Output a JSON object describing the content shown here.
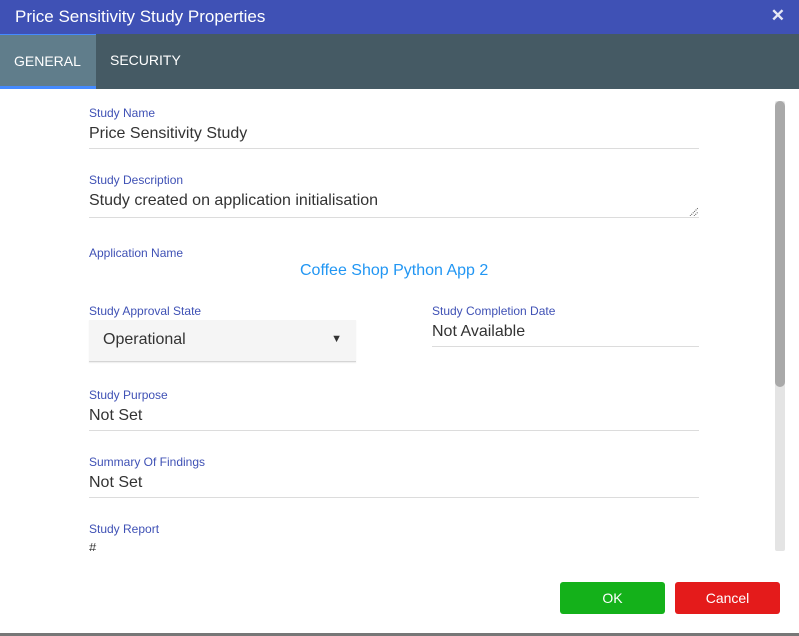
{
  "dialog": {
    "title": "Price Sensitivity Study Properties",
    "close_icon": "close-icon"
  },
  "tabs": [
    {
      "label": "GENERAL",
      "active": true
    },
    {
      "label": "SECURITY",
      "active": false
    }
  ],
  "fields": {
    "study_name": {
      "label": "Study Name",
      "value": "Price Sensitivity Study"
    },
    "study_description": {
      "label": "Study Description",
      "value": "Study created on application initialisation"
    },
    "application_name": {
      "label": "Application Name",
      "value": "Coffee Shop Python App 2"
    },
    "approval_state": {
      "label": "Study Approval State",
      "value": "Operational"
    },
    "completion_date": {
      "label": "Study Completion Date",
      "value": "Not Available"
    },
    "study_purpose": {
      "label": "Study Purpose",
      "value": "Not Set"
    },
    "summary_of_findings": {
      "label": "Summary Of Findings",
      "value": "Not Set"
    },
    "study_report": {
      "label": "Study Report",
      "value": "#"
    }
  },
  "buttons": {
    "ok": "OK",
    "cancel": "Cancel"
  },
  "colors": {
    "titlebar": "#3f51b5",
    "tabbar": "#455a64",
    "active_tab": "#607d8b",
    "label": "#3f51b5",
    "link": "#2196f3",
    "ok": "#14b11a",
    "cancel": "#e41b1b"
  }
}
